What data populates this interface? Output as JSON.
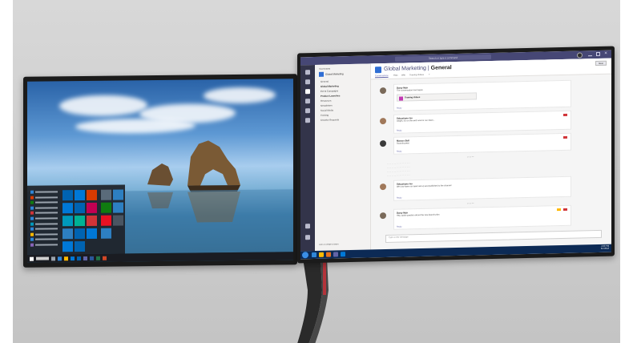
{
  "colors": {
    "wall": "#d0d0d0",
    "teams_purple": "#464775",
    "teams_accent": "#6264a7",
    "windows_blue": "#0078d7",
    "reaction_red": "#d13438"
  },
  "left_monitor": {
    "taskbar_icons": [
      "start-icon",
      "search-icon",
      "task-view-icon",
      "edge-icon",
      "file-explorer-icon",
      "store-icon",
      "mail-icon"
    ]
  },
  "right_monitor": {
    "search_placeholder": "Search or type a command",
    "channel_list": {
      "section": "Your teams",
      "team_name": "Global Marketing",
      "channels": [
        "General",
        "Global Marketing",
        "Event Campaigns",
        "Product Launches",
        "Resources",
        "Newsletters",
        "Social Media",
        "Training",
        "Creative Requests"
      ],
      "create_team": "Join or create a team"
    },
    "channel_header": {
      "team": "Global Marketing",
      "channel": "General",
      "tabs": [
        "Conversations",
        "Files",
        "Wiki",
        "Training Videos",
        "+"
      ],
      "meet_button": "Meet"
    },
    "posts": [
      {
        "author": "Daisy Muir",
        "text": "The conversation has begun",
        "attachment": "Training Videos",
        "reply": "Reply"
      },
      {
        "author": "Sebastiano Ivo",
        "text": "Alright, it's on the web now for our team...",
        "reply": "Reply"
      },
      {
        "author": "Marcus Bull",
        "text": "Sounds great",
        "reply": "Reply"
      },
      {
        "author": "Sebastiano Ivo",
        "text": "We now have our team set up and published to the channel",
        "reply": "Reply"
      },
      {
        "author": "Daisy Muir",
        "text": "Hey, quick question about the new launch plan",
        "reply": "Reply"
      }
    ],
    "compose_placeholder": "Type a new message",
    "clock": {
      "time": "2:30 PM",
      "date": "6/7/2018"
    }
  }
}
